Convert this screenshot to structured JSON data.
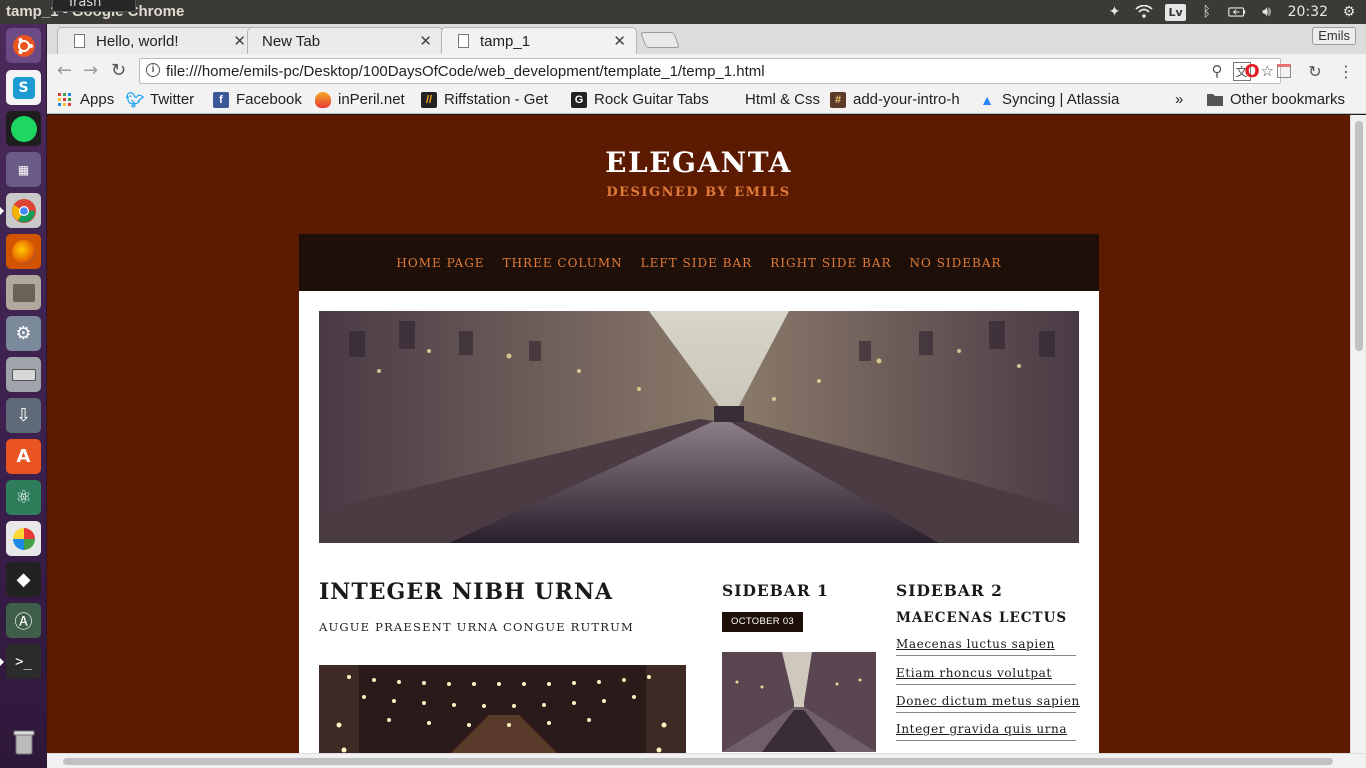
{
  "os": {
    "window_title": "tamp_1 - Google Chrome",
    "tooltip": "Trash",
    "keyboard_layout": "Lv",
    "clock": "20:32"
  },
  "browser": {
    "tabs": [
      {
        "title": "Hello, world!"
      },
      {
        "title": "New Tab"
      },
      {
        "title": "tamp_1"
      }
    ],
    "profile_name": "Emils",
    "url": "file:///home/emils-pc/Desktop/100DaysOfCode/web_development/template_1/temp_1.html",
    "bookmarks": [
      {
        "label": "Apps",
        "icon": "apps-grid-icon"
      },
      {
        "label": "Twitter",
        "icon": "twitter-icon"
      },
      {
        "label": "Facebook",
        "icon": "facebook-icon"
      },
      {
        "label": "inPeril.net",
        "icon": "inperil-icon"
      },
      {
        "label": "Riffstation - Get",
        "icon": "riffstation-icon"
      },
      {
        "label": "Rock Guitar Tabs",
        "icon": "g-icon"
      },
      {
        "label": "Html & Css",
        "icon": "none"
      },
      {
        "label": "add-your-intro-h",
        "icon": "hash-icon"
      },
      {
        "label": "Syncing | Atlassia",
        "icon": "atlassian-icon"
      },
      {
        "label": "»",
        "icon": "overflow"
      },
      {
        "label": "Other bookmarks",
        "icon": "folder-icon"
      }
    ]
  },
  "site": {
    "title": "ELEGANTA",
    "subtitle": "DESIGNED BY EMILS",
    "nav": [
      "HOME PAGE",
      "THREE COLUMN",
      "LEFT SIDE BAR",
      "RIGHT SIDE BAR",
      "NO SIDEBAR"
    ],
    "post": {
      "title": "INTEGER NIBH URNA",
      "subtitle": "AUGUE PRAESENT URNA CONGUE RUTRUM"
    },
    "sidebar1": {
      "title": "SIDEBAR 1",
      "date": "OCTOBER 03"
    },
    "sidebar2": {
      "title": "SIDEBAR 2",
      "heading": "MAECENAS LECTUS",
      "links": [
        "Maecenas luctus sapien",
        "Etiam rhoncus volutpat",
        "Donec dictum metus sapien",
        "Integer gravida quis urna"
      ]
    },
    "colors": {
      "background": "#5c1a00",
      "nav_bg": "#1e1008",
      "accent": "#e07a3a"
    }
  }
}
